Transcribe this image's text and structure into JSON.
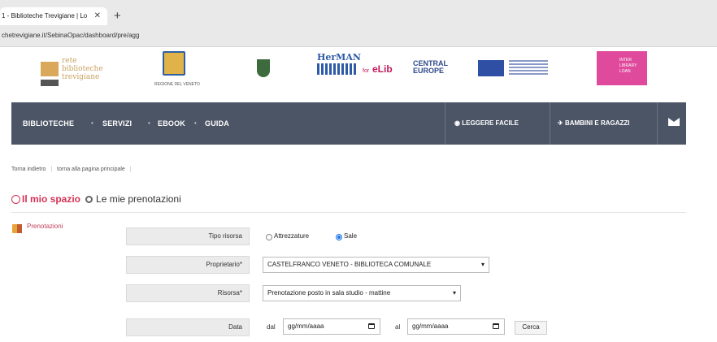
{
  "browser": {
    "tab_title": "1 - Biblioteche Trevigiane | Lo",
    "tab_close": "✕",
    "new_tab": "+",
    "address": "chetrevigiane.it/SebinaOpac/dashboard/pre/agg"
  },
  "logos": {
    "rete_text": "rete biblioteche trevigiane",
    "regione_caption": "REGIONE DEL VENETO",
    "herman": "HerMAN",
    "for": "for",
    "elib": "eLib",
    "central_europe": "CENTRAL EUROPE",
    "interlib": "INTER LIBRARY LOAN"
  },
  "nav": {
    "items": [
      "BIBLIOTECHE",
      "SERVIZI",
      "EBOOK",
      "GUIDA"
    ],
    "separator": "•",
    "leggere_facile": "LEGGERE FACILE",
    "bambini": "BAMBINI E RAGAZZI"
  },
  "breadcrumb": {
    "back": "Torna indietro",
    "home": "torna alla pagina principale",
    "sep": "|"
  },
  "header": {
    "mio_spazio": "Il mio spazio",
    "prenotazioni": "Le mie prenotazioni"
  },
  "sidebar": {
    "prenotazioni": "Prenotazioni"
  },
  "form": {
    "tipo_risorsa_label": "Tipo risorsa",
    "radio_attrezzature": "Attrezzature",
    "radio_sale": "Sale",
    "selected_radio": "Sale",
    "proprietario_label": "Proprietario*",
    "proprietario_value": "CASTELFRANCO VENETO - BIBLIOTECA COMUNALE",
    "risorsa_label": "Risorsa*",
    "risorsa_value": "Prenotazione posto in sala studio - mattine",
    "data_label": "Data",
    "dal": "dal",
    "al": "al",
    "date_placeholder": "gg/mm/aaaa",
    "cerca": "Cerca"
  },
  "colors": {
    "nav_bg": "#4c5566",
    "accent": "#d23356",
    "radio_selected": "#1a73e8"
  }
}
